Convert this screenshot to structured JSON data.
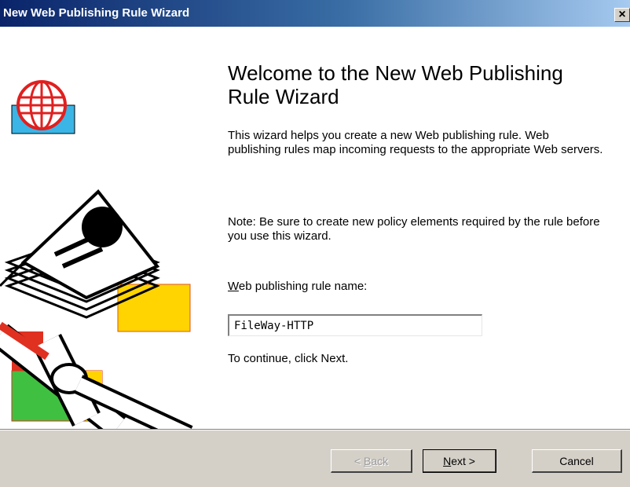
{
  "window": {
    "title": "New Web Publishing Rule Wizard",
    "close_glyph": "×",
    "close_icon": "close-icon"
  },
  "main": {
    "heading": "Welcome to the New Web Publishing Rule Wizard",
    "description": "This wizard helps you create a new Web publishing rule. Web publishing rules map incoming requests to the appropriate Web servers.",
    "note": "Note: Be sure to create new policy elements required by the rule before you use this wizard.",
    "name_label_accel": "W",
    "name_label_rest": "eb publishing rule name:",
    "name_value": "FileWay-HTTP",
    "continue_text": "To continue, click Next."
  },
  "buttons": {
    "back": {
      "prefix": "< ",
      "accel": "B",
      "rest": "ack",
      "enabled": false
    },
    "next": {
      "accel": "N",
      "rest": "ext >",
      "enabled": true
    },
    "cancel": {
      "label": "Cancel",
      "enabled": true
    }
  },
  "illustration": {
    "icons": [
      "globe-icon",
      "document-stack-icon",
      "pipe-icon"
    ],
    "colors": {
      "globe": "#e02020",
      "blue_band": "#3ab5e6",
      "yellow": "#ffd400",
      "green": "#40c040",
      "red": "#e03020"
    }
  }
}
